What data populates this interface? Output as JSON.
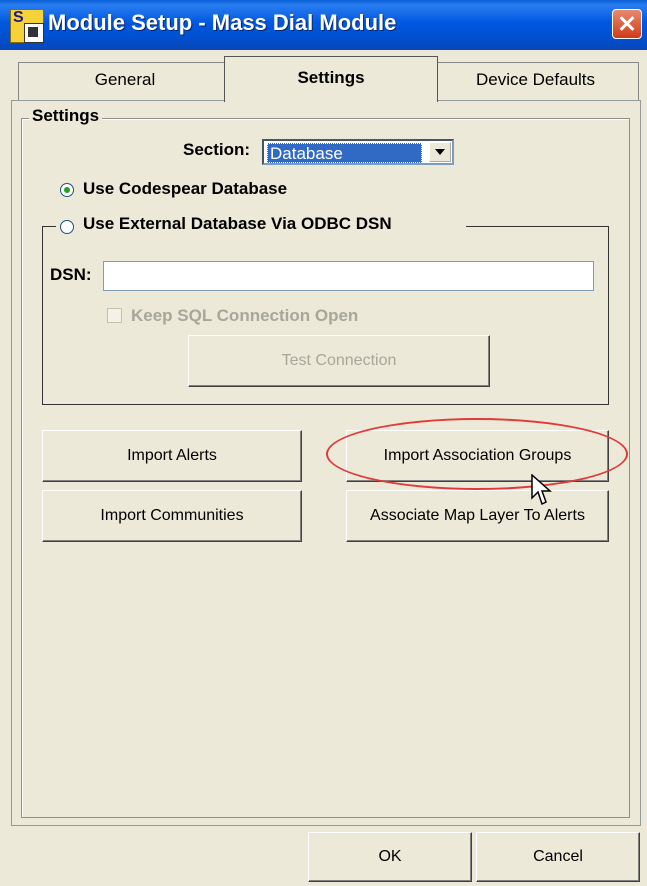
{
  "window": {
    "title": "Module Setup - Mass Dial Module",
    "icon": "app-icon",
    "close_icon": "close-icon"
  },
  "tabs": [
    {
      "label": "General",
      "selected": false
    },
    {
      "label": "Settings",
      "selected": true
    },
    {
      "label": "Device Defaults",
      "selected": false
    }
  ],
  "settings": {
    "group_label": "Settings",
    "section_label": "Section:",
    "section_value": "Database",
    "use_codespear_label": "Use Codespear Database",
    "use_codespear_checked": true,
    "use_external_label": "Use External Database Via ODBC DSN",
    "use_external_checked": false,
    "dsn_label": "DSN:",
    "dsn_value": "",
    "keep_sql_label": "Keep SQL Connection Open",
    "keep_sql_checked": false,
    "test_connection_label": "Test Connection"
  },
  "actions": {
    "import_alerts": "Import Alerts",
    "import_communities": "Import Communities",
    "import_association_groups": "Import Association Groups",
    "associate_map_layer": "Associate Map Layer To Alerts"
  },
  "footer": {
    "ok": "OK",
    "cancel": "Cancel"
  },
  "colors": {
    "dialog_bg": "#ece9d8",
    "titlebar": "#0058e0",
    "selection": "#316ac5",
    "highlight_circle": "#e03a3a",
    "disabled_text": "#a7a69b"
  }
}
